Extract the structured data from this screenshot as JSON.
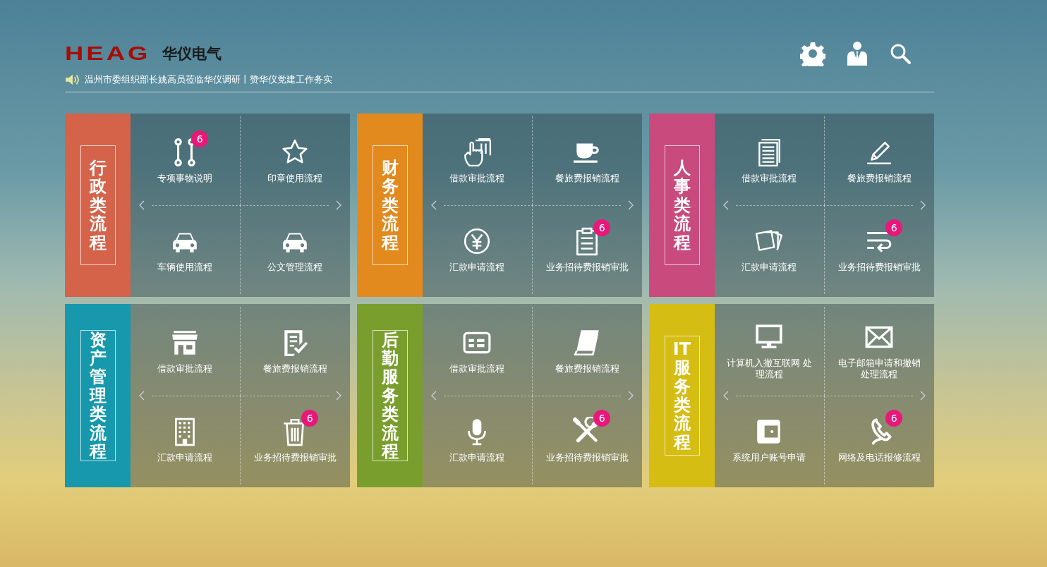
{
  "header": {
    "logo_mark": "HEAG",
    "logo_name": "华仪电气",
    "ticker": "温州市委组织部长姚高员莅临华仪调研丨赞华仪党建工作务实"
  },
  "groups": [
    {
      "title": "行政类流程",
      "color": "#d4634a",
      "rows": [
        {
          "items": [
            {
              "kind": "nodes",
              "label": "专项事物说明",
              "badge": "6"
            },
            {
              "kind": "star",
              "label": "印章使用流程"
            }
          ]
        },
        {
          "items": [
            {
              "kind": "car",
              "label": "车辆使用流程"
            },
            {
              "kind": "car",
              "label": "公文管理流程"
            }
          ]
        }
      ]
    },
    {
      "title": "财务类流程",
      "color": "#e38a1f",
      "rows": [
        {
          "items": [
            {
              "kind": "hand-card",
              "label": "借款审批流程"
            },
            {
              "kind": "cup",
              "label": "餐旅费报销流程"
            }
          ]
        },
        {
          "items": [
            {
              "kind": "yen",
              "label": "汇款申请流程"
            },
            {
              "kind": "clipboard",
              "label": "业务招待费报销审批",
              "badge": "6"
            }
          ]
        }
      ]
    },
    {
      "title": "人事类流程",
      "color": "#c94a7c",
      "rows": [
        {
          "items": [
            {
              "kind": "document",
              "label": "借款审批流程"
            },
            {
              "kind": "pencil",
              "label": "餐旅费报销流程"
            }
          ]
        },
        {
          "items": [
            {
              "kind": "photos",
              "label": "汇款申请流程"
            },
            {
              "kind": "wrap",
              "label": "业务招待费报销审批",
              "badge": "6"
            }
          ]
        }
      ]
    },
    {
      "title": "资产管理类流程",
      "color": "#1798ac",
      "rows": [
        {
          "items": [
            {
              "kind": "store",
              "label": "借款审批流程"
            },
            {
              "kind": "checklist",
              "label": "餐旅费报销流程"
            }
          ]
        },
        {
          "items": [
            {
              "kind": "building",
              "label": "汇款申请流程"
            },
            {
              "kind": "trash",
              "label": "业务招待费报销审批",
              "badge": "6"
            }
          ]
        }
      ]
    },
    {
      "title": "后勤服务类流程",
      "color": "#7a9e2e",
      "rows": [
        {
          "items": [
            {
              "kind": "id-card",
              "label": "借款审批流程"
            },
            {
              "kind": "book",
              "label": "餐旅费报销流程"
            }
          ]
        },
        {
          "items": [
            {
              "kind": "mic",
              "label": "汇款申请流程"
            },
            {
              "kind": "tools",
              "label": "业务招待费报销审批",
              "badge": "6"
            }
          ]
        }
      ]
    },
    {
      "title": "IT服务类流程",
      "color": "#d6bd14",
      "rows": [
        {
          "items": [
            {
              "kind": "monitor",
              "label": "计算机入撤互联网 处理流程"
            },
            {
              "kind": "mail",
              "label": "电子邮箱申请和撤销处理流程"
            }
          ]
        },
        {
          "items": [
            {
              "kind": "wallet",
              "label": "系统用户账号申请"
            },
            {
              "kind": "phone",
              "label": "网络及电话报修流程",
              "badge": "6"
            }
          ]
        }
      ]
    }
  ]
}
